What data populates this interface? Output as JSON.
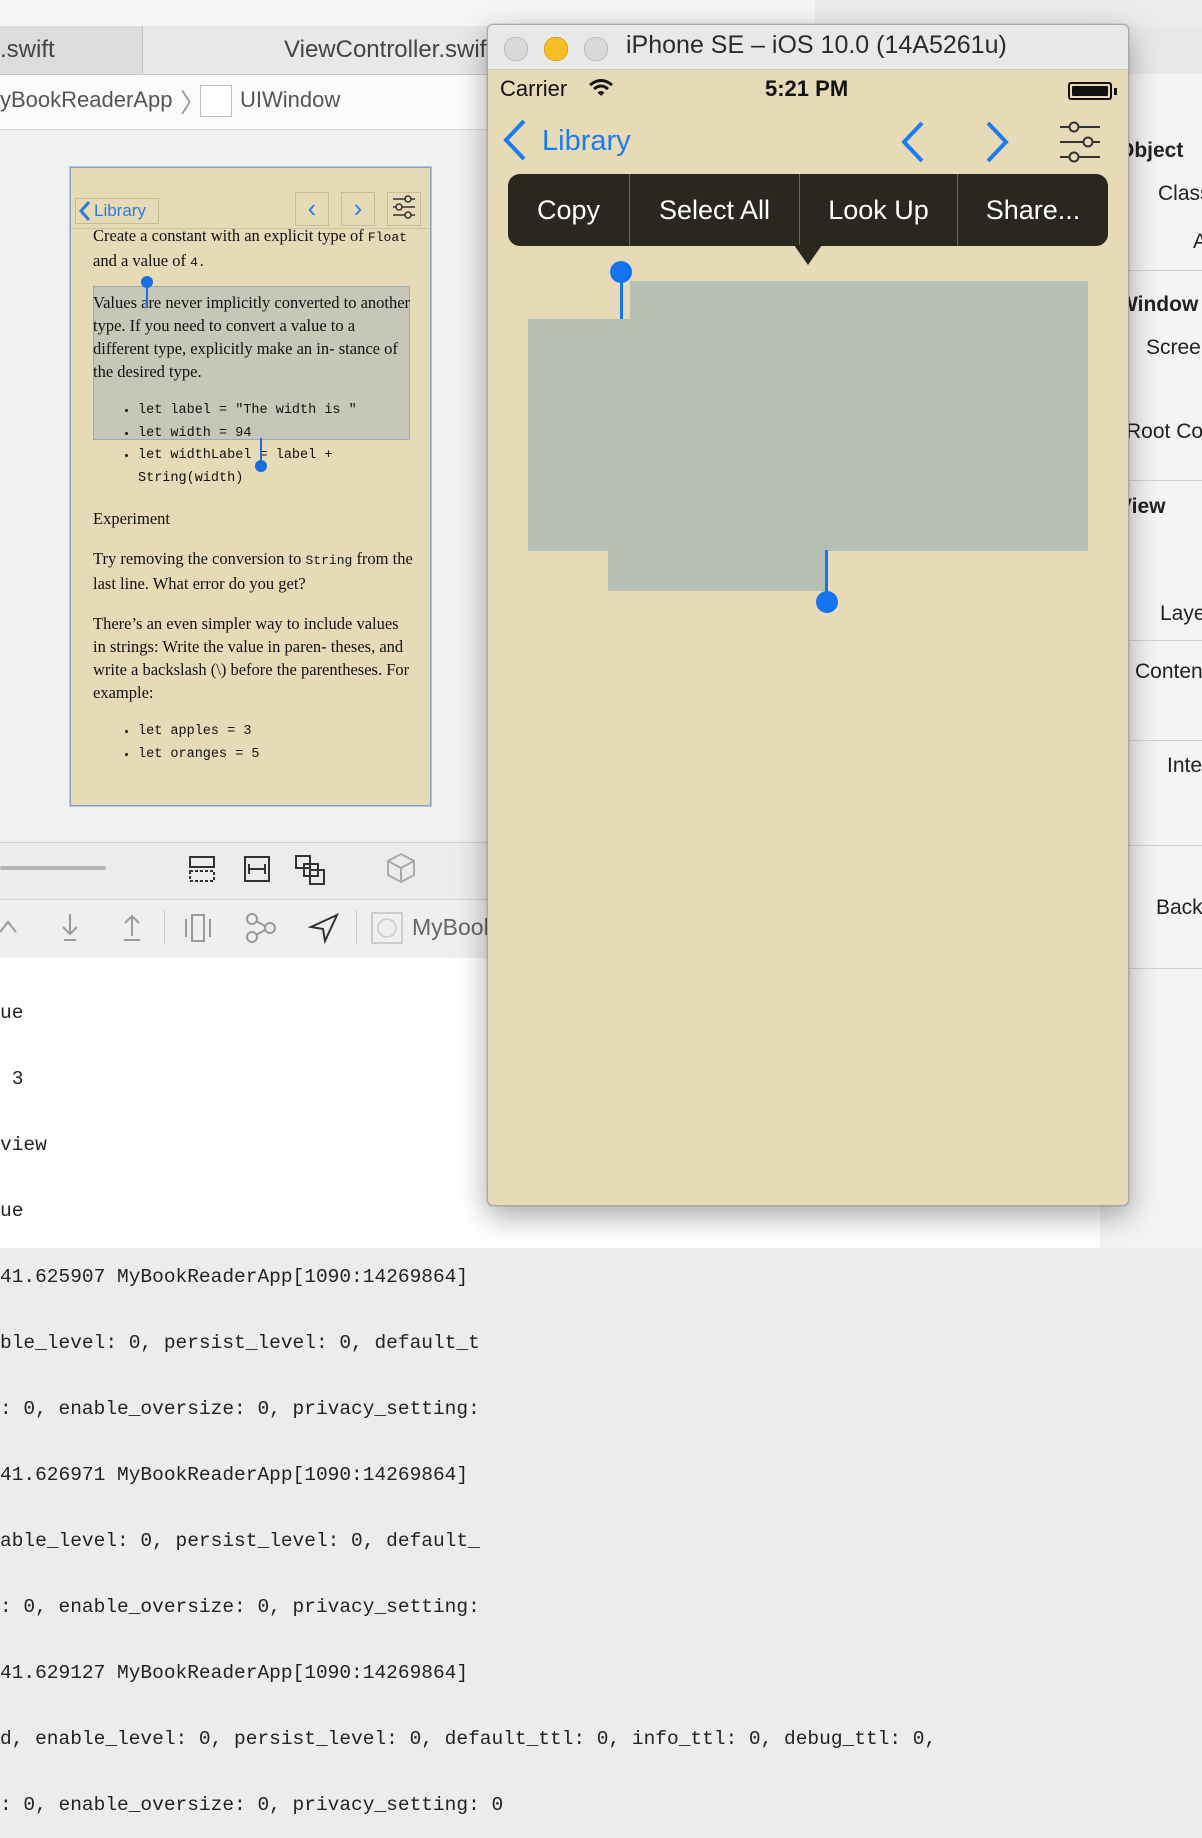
{
  "xcode": {
    "tabs": [
      ".swift",
      "ViewController.swift"
    ],
    "jumpbar": {
      "app": "yBookReaderApp",
      "separator": "〉",
      "window": "UIWindow"
    },
    "debug_target": "MyBook",
    "inspector": {
      "items": [
        "Object",
        "Class",
        "A",
        "Window",
        "Scree",
        "Root Co",
        "View",
        "Laye",
        "Conten",
        "Inte",
        "Back"
      ]
    },
    "console_lines": [
      "ue",
      " 3",
      "view",
      "ue",
      "41.625907 MyBookReaderApp[1090:14269864]",
      "ble_level: 0, persist_level: 0, default_t",
      ": 0, enable_oversize: 0, privacy_setting:",
      "41.626971 MyBookReaderApp[1090:14269864]",
      "able_level: 0, persist_level: 0, default_",
      ": 0, enable_oversize: 0, privacy_setting:",
      "41.629127 MyBookReaderApp[1090:14269864]",
      "d, enable_level: 0, persist_level: 0, default_ttl: 0, info_ttl: 0, debug_ttl: 0,",
      ": 0, enable_oversize: 0, privacy_setting: 0"
    ]
  },
  "storyboard": {
    "back_label": "Library",
    "para1_a": "Create a constant with an explicit type of",
    "para1_code1": "Float",
    "para1_b": "and a value of",
    "para1_code2": "4.",
    "para2": "Values are never implicitly converted to another type. If you need to convert a value to a different type, explicitly make an in- stance of the desired type.",
    "code1": [
      "let label = \"The width is \"",
      "let width = 94",
      "let widthLabel = label +",
      "String(width)"
    ],
    "para3": "Experiment",
    "para4_a": "Try removing the conversion to",
    "para4_code": "String",
    "para4_b": "from the last line. What error do you get?",
    "para5": "There’s an even simpler way to include values in strings: Write the value in paren- theses, and write a backslash (\\) before the parentheses. For example:",
    "code2": [
      "let apples = 3",
      "let oranges = 5"
    ]
  },
  "simulator": {
    "title": "iPhone SE – iOS 10.0 (14A5261u)",
    "status": {
      "carrier": "Carrier",
      "time": "5:21 PM"
    },
    "nav": {
      "back_label": "Library"
    },
    "edit_menu": [
      "Copy",
      "Select All",
      "Look Up",
      "Share..."
    ],
    "colors": {
      "page": "#e6dab7",
      "tint": "#1e7cf2",
      "selection": "#b7bfb5",
      "menu": "#2a2620"
    }
  }
}
